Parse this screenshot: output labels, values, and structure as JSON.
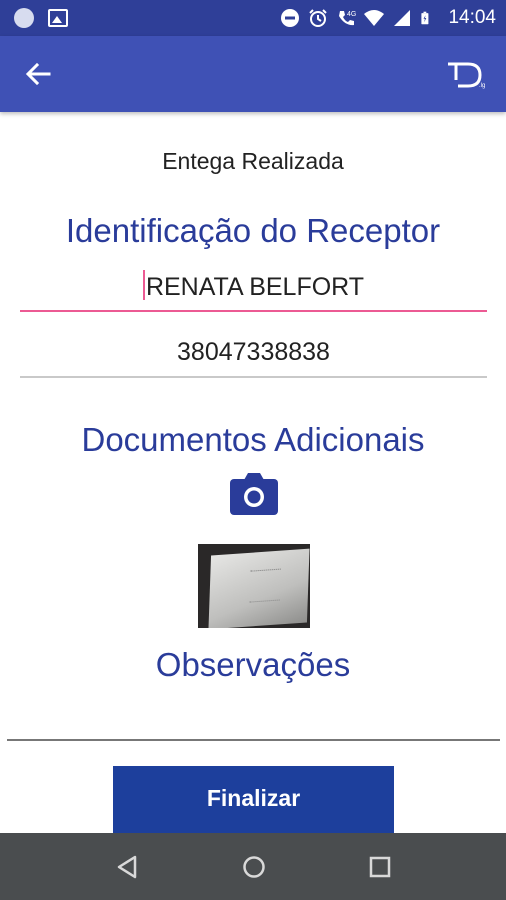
{
  "status_bar": {
    "time": "14:04",
    "network": "4G",
    "icons": [
      "notification-dot-icon",
      "image-icon",
      "dnd-icon",
      "alarm-icon",
      "call-icon",
      "wifi-icon",
      "signal-icon",
      "battery-icon"
    ]
  },
  "app_bar": {
    "back_icon": "arrow-left-icon",
    "logo_icon": "app-logo-icon"
  },
  "page": {
    "status_text": "Entega Realizada",
    "receiver_section_title": "Identificação do Receptor",
    "receiver_name": "RENATA BELFORT",
    "receiver_document": "38047338838",
    "docs_section_title": "Documentos Adicionais",
    "camera_icon": "camera-icon",
    "observations_title": "Observações",
    "finalize_label": "Finalizar"
  },
  "nav_bar": {
    "back_icon": "nav-back-icon",
    "home_icon": "nav-home-icon",
    "recents_icon": "nav-recents-icon"
  },
  "colors": {
    "status_bar": "#2f3f98",
    "app_bar": "#3f51b5",
    "accent_text": "#2a3c9a",
    "input_focus": "#ec5a93",
    "button": "#1d3f9c",
    "nav_bar": "#4a4d4f"
  }
}
